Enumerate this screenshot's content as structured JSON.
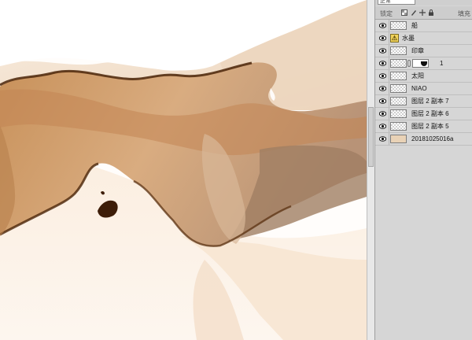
{
  "layers_panel": {
    "blend_mode": "正常",
    "lock_label": "锁定",
    "fill_label": "填充",
    "layers": [
      {
        "name": "船",
        "thumb": "transparent"
      },
      {
        "name": "水墨",
        "thumb": "smart-object"
      },
      {
        "name": "印章",
        "thumb": "transparent"
      },
      {
        "name": "1",
        "thumb": "transparent-with-mask"
      },
      {
        "name": "太阳",
        "thumb": "transparent"
      },
      {
        "name": "NIAO",
        "thumb": "transparent"
      },
      {
        "name": "图层 2 副本 7",
        "thumb": "transparent"
      },
      {
        "name": "图层 2 副本 6",
        "thumb": "transparent"
      },
      {
        "name": "图层 2 副本 5",
        "thumb": "transparent"
      },
      {
        "name": "20181025016a",
        "thumb": "photo"
      }
    ]
  },
  "colors": {
    "canvas_bg": "#fffdfb",
    "ink_dark": "#5a3010",
    "ink_mid": "#b07a4a",
    "ink_light": "#e8c9a5",
    "panel_bg": "#d6d6d6"
  }
}
